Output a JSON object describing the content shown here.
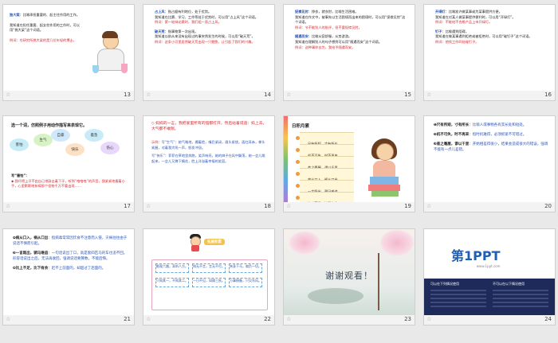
{
  "slides": [
    {
      "num": "13",
      "lines": [
        {
          "head": "独大案",
          "text": "：比喻承担重要的、起主往作用的工作。",
          "red": false
        },
        {
          "head": "",
          "text": "我知道在担任重要、起支柱作用的工作时，可以用“挑大梁”这个词语。",
          "red": false
        },
        {
          "head": "例词",
          "text": "：在研究所挑大梁的是几位年轻的博士。",
          "red": true
        }
      ]
    },
    {
      "num": "14",
      "lines": [
        {
          "head": "占上风",
          "text": "：指占据有利地位，处于优势。",
          "red": false
        },
        {
          "head": "",
          "text": "我知道在比赛、学习、工作等处于优势时，可以用“占上风”这个词语。",
          "red": false
        },
        {
          "head": "例词",
          "text": "：第一轮辩论赛时，我们组一直占上风。",
          "red": true
        },
        {
          "head": "破天荒",
          "text": "：指事物第一次出现。",
          "red": false
        },
        {
          "head": "",
          "text": "我知道以前从来没有出现过的事突然发生的时候，可以用“破天荒”。",
          "red": false
        },
        {
          "head": "例词",
          "text": "：这条小河里居然破天荒出现一只鲤鱼，让引起了我们的兴趣。",
          "red": true
        }
      ]
    },
    {
      "num": "15",
      "lines": [
        {
          "head": "捉襟见肘",
          "text": "：挣衣，就衣肘，比喻生活困难。",
          "red": false
        },
        {
          "head": "",
          "text": "我知道在作文中，被事先以生活困境而出来的困境时，可以用“捉襟见肘”这个词语。",
          "red": false
        },
        {
          "head": "例词",
          "text": "：节不能别人的批评，但不要捉襟见肘。",
          "red": true
        },
        {
          "head": "随遇而安",
          "text": "：比喻从容舒服，从势游游。",
          "red": false
        },
        {
          "head": "",
          "text": "我知道在理解别人的句子想到可以用“随遇而安”这个词语。",
          "red": false
        },
        {
          "head": "例词",
          "text": "：这种事你去为，我给予随遇而安。",
          "red": true
        }
      ]
    },
    {
      "num": "16",
      "lines": [
        {
          "head": "开绿灯",
          "text": "：比喻准许做某事或为某事提供方便。",
          "red": false
        },
        {
          "head": "",
          "text": "我知道在对某人做某事提供便利时，可以用“开绿灯”。",
          "red": false
        },
        {
          "head": "例词",
          "text": "：不能给不合格产品上市开绿灯。",
          "red": true
        },
        {
          "head": "钉子",
          "text": "：比喻遇到阻碍。",
          "red": false
        },
        {
          "head": "",
          "text": "我知道在做某事遇到拒绝或被拒绝时，可以用“碰钉子”这个词语。",
          "red": false
        },
        {
          "head": "例词",
          "text": "：他找工作四处碰钉子。",
          "red": true
        }
      ]
    },
    {
      "num": "17",
      "title": "选一个词，仿照例子用动作描写来表现它。",
      "clouds": [
        "害怕",
        "生气",
        "自豪",
        "快乐",
        "着急",
        "伤心"
      ],
      "lines": [
        {
          "head": "写“害怕”",
          "text": "：",
          "red": false
        },
        {
          "head": "",
          "text": "◆ 我吓得上牙不由自己地敲击着下牙，听到“咯咯咯”的声音，我紧紧地握着小手，心里默默地祈祷那个怪物千万不要出现……",
          "red": true
        }
      ]
    },
    {
      "num": "18",
      "title": "◇ 妈妈的一言，我把爱里所有的恼都打开，然后站着说道：妈上去，大气都不敢喘。",
      "lines": [
        {
          "head": "示例",
          "text": "：写“生气”：她气喘地，绷着脸，嘴巴紧闭，眉头紧锁，面红耳赤，拳头紧握，对着我大吼一声，怒发冲冠。",
          "red": false
        },
        {
          "head": "",
          "text": "写“快乐”：菲菲在草地里奔跑，笑声响亮，她的辫子在风中飘荡，她一会儿跳起来，一会儿又蹲下摘花，脸上洋溢着幸福的笑容。",
          "red": false
        }
      ]
    },
    {
      "num": "19",
      "title": "日积月累",
      "items": [
        "尺有所短，寸有所长。",
        "机不可失，时不再来。",
        "差之毫厘，谬以千里。",
        "病从口入，祸从口出。",
        "一言既出，驷马难追。",
        "比上不足，比下有余。"
      ]
    },
    {
      "num": "20",
      "lines": [
        {
          "head": "❶尺有所短，寸有所长",
          "text": "：比喻人或事物各有其长处和短处。",
          "red": false
        },
        {
          "head": "❷机不可失，时不再来",
          "text": "：指时机难得，必须抓紧不可错过。",
          "red": false
        },
        {
          "head": "❸差之毫厘，谬以千里",
          "text": "：开始相差得很小，结果会造成很大的错误，强调不能有一点儿差错。",
          "red": false
        }
      ]
    },
    {
      "num": "21",
      "lines": [
        {
          "head": "❹病从口入，祸从口出",
          "text": "：指病毒常常因饮食不注意而入侵，灾祸往往由于说话不慎而引起。",
          "red": false
        },
        {
          "head": "❺一言既出，驷马难追",
          "text": "：一句话说出了口，就是套四匹马的车也追不回。形容话说出之后，无法再收回，强调说话要算数，不能后悔。",
          "red": false
        },
        {
          "head": "❻比上不足，比下有余",
          "text": "：赶不上前面的，却超过了后面的。",
          "red": false
        }
      ]
    },
    {
      "num": "22",
      "title": "拓展积累",
      "boxes": [
        "眼观六路，耳听八方。",
        "知无不言，言无不尽。",
        "亲身下马，肩负一切。",
        "只知其一，不知其二。",
        "一日不见，如隔三秋。",
        "万事俱备，只欠东风。"
      ]
    },
    {
      "num": "23",
      "title": "谢谢观看！"
    },
    {
      "num": "24",
      "brand": "第1PPT",
      "brand_url": "www.1ppt.com",
      "left_title": "可以在下列情况使用",
      "right_title": "不可以在以下情况使用"
    }
  ]
}
